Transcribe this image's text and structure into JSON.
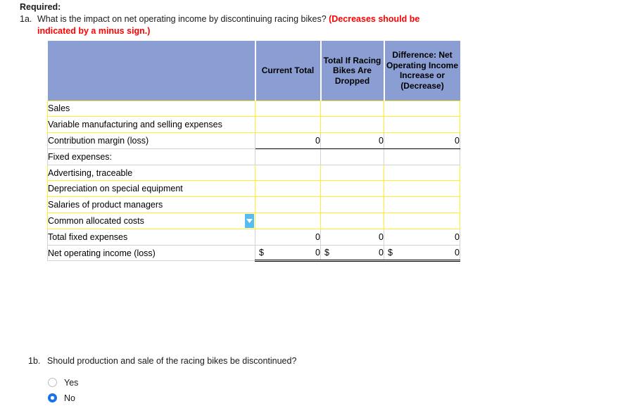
{
  "prompt": {
    "required_label": "Required:",
    "q1a_num": "1a.",
    "q1a_text": "What is the impact on net operating income by discontinuing racing bikes?",
    "q1a_emphasis": "(Decreases should be indicated by a minus sign.)"
  },
  "worksheet": {
    "columns": [
      {
        "header": ""
      },
      {
        "header": "Current Total"
      },
      {
        "header": "Total If Racing Bikes Are Dropped"
      },
      {
        "header": "Difference: Net Operating Income Increase or (Decrease)"
      }
    ],
    "rows": [
      {
        "label": "Sales",
        "c1": "",
        "c2": "",
        "c3": ""
      },
      {
        "label": "Variable manufacturing and selling expenses",
        "c1": "",
        "c2": "",
        "c3": ""
      },
      {
        "label": "Contribution margin (loss)",
        "c1": "0",
        "c2": "0",
        "c3": "0"
      },
      {
        "label": "Fixed expenses:",
        "c1": "",
        "c2": "",
        "c3": ""
      },
      {
        "label": "Advertising, traceable",
        "c1": "",
        "c2": "",
        "c3": ""
      },
      {
        "label": "Depreciation on special equipment",
        "c1": "",
        "c2": "",
        "c3": ""
      },
      {
        "label": "Salaries of product managers",
        "c1": "",
        "c2": "",
        "c3": ""
      },
      {
        "label": "Common allocated costs",
        "c1": "",
        "c2": "",
        "c3": ""
      },
      {
        "label": "Total fixed expenses",
        "c1": "0",
        "c2": "0",
        "c3": "0"
      },
      {
        "label": "Net operating income (loss)",
        "c1": "0",
        "c2": "0",
        "c3": "0"
      }
    ],
    "currency_symbol": "$",
    "dropdown_icon": "chevron-down-icon"
  },
  "q1b": {
    "num": "1b.",
    "text": "Should production and sale of the racing bikes be discontinued?",
    "options": [
      {
        "label": "Yes",
        "selected": false
      },
      {
        "label": "No",
        "selected": true
      }
    ]
  },
  "colors": {
    "header_blue": "#8b9ed4",
    "editable_border": "#ffef2e",
    "emphasis_red": "#ff0000",
    "radio_selected": "#1a73e8",
    "dropdown_button": "#57bdf0",
    "focus_border": "#1c5d52"
  }
}
